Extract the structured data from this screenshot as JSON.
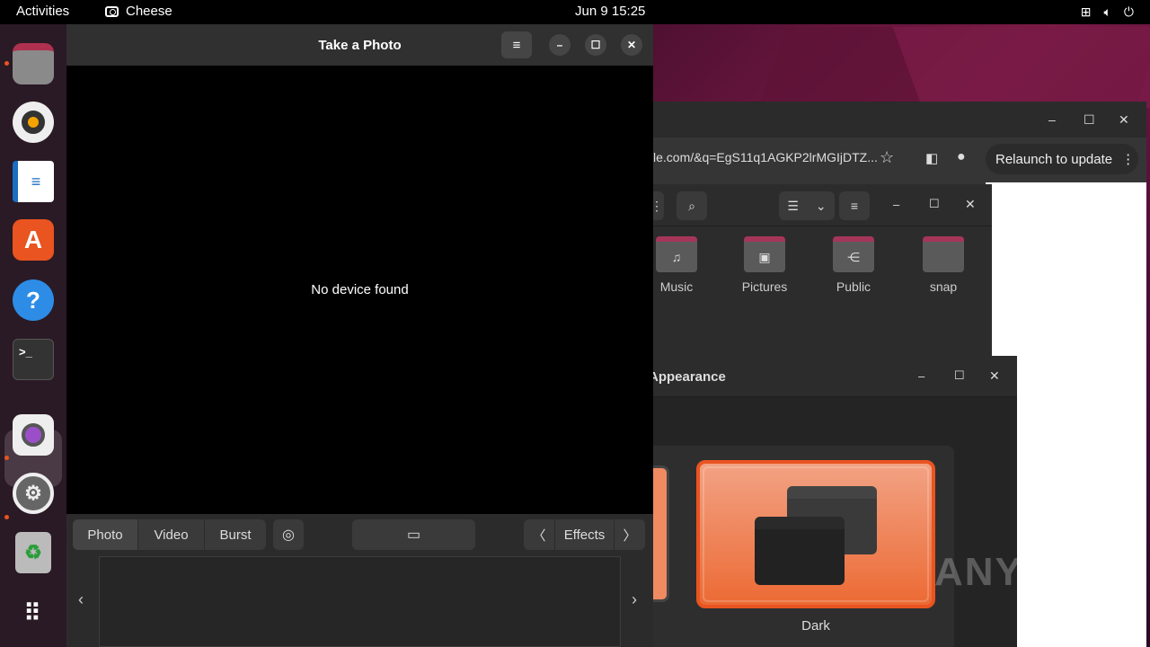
{
  "topbar": {
    "activities": "Activities",
    "app_name": "Cheese",
    "clock": "Jun 9  15:25",
    "tray_icons": [
      "network-icon",
      "volume-icon",
      "power-icon"
    ]
  },
  "dock": {
    "items": [
      "files",
      "rhythmbox",
      "libreoffice-writer",
      "ubuntu-software",
      "help",
      "terminal",
      "cheese",
      "settings",
      "trash",
      "show-apps"
    ]
  },
  "cheese": {
    "title": "Take a Photo",
    "message": "No device found",
    "modes": [
      "Photo",
      "Video",
      "Burst"
    ],
    "effects_label": "Effects"
  },
  "browser": {
    "url": "le.com/&q=EgS11q1AGKP2lrMGIjDTZ...",
    "relaunch_label": "Relaunch to update"
  },
  "files": {
    "folders": [
      "Music",
      "Pictures",
      "Public",
      "snap"
    ]
  },
  "appearance": {
    "title": "Appearance",
    "theme_label": "Dark"
  },
  "watermark": "ANY RUN"
}
